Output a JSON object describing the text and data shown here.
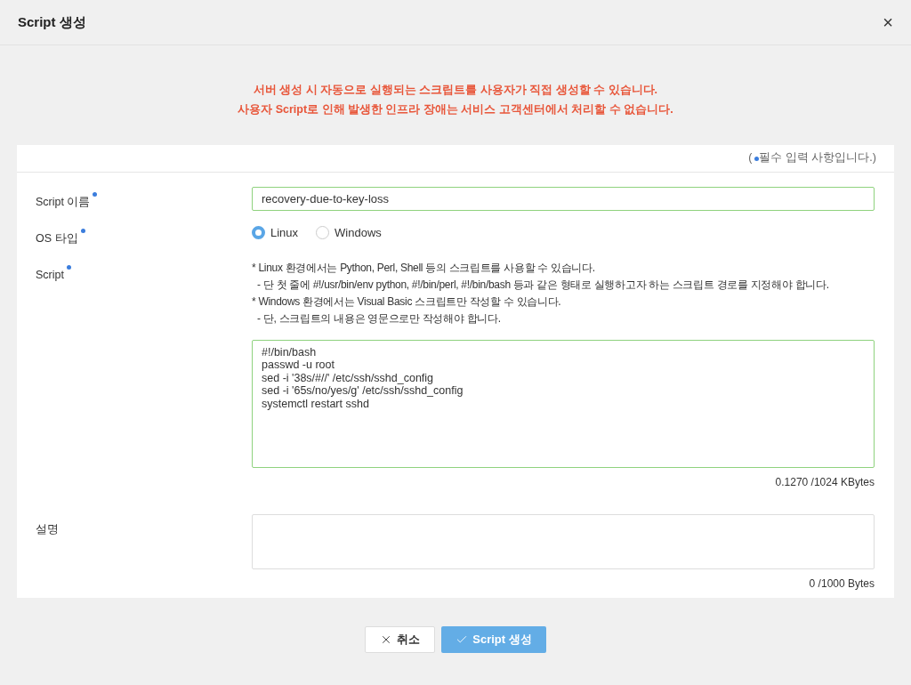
{
  "dialog": {
    "title": "Script 생성",
    "close": "×"
  },
  "notice": [
    "서버 생성 시 자동으로 실행되는 스크립트를 사용자가 직접 생성할 수 있습니다.",
    "사용자 Script로 인해 발생한 인프라 장애는 서비스 고객센터에서 처리할 수 없습니다."
  ],
  "required_note": {
    "open": "(",
    "text": "필수 입력 사항입니다.)"
  },
  "fields": [
    {
      "kind": "text",
      "label": "Script 이름",
      "required": true,
      "value": "recovery-due-to-key-loss"
    },
    {
      "kind": "radio",
      "label": "OS 타입",
      "required": true,
      "options": [
        {
          "label": "Linux",
          "selected": true
        },
        {
          "label": "Windows",
          "selected": false
        }
      ]
    },
    {
      "kind": "script",
      "label": "Script",
      "required": true,
      "help": [
        "* Linux 환경에서는 Python, Perl, Shell 등의 스크립트를 사용할 수 있습니다.",
        "  - 단 첫 줄에 #!/usr/bin/env python, #!/bin/perl, #!/bin/bash 등과 같은 형태로 실행하고자 하는 스크립트 경로를 지정해야 합니다.",
        "* Windows 환경에서는 Visual Basic 스크립트만 작성할 수 있습니다.",
        "  - 단, 스크립트의 내용은 영문으로만 작성해야 합니다."
      ],
      "value": "#!/bin/bash\npasswd -u root\nsed -i '38s/#//' /etc/ssh/sshd_config\nsed -i '65s/no/yes/g' /etc/ssh/sshd_config\nsystemctl restart sshd",
      "counter": "0.1270 /1024 KBytes"
    },
    {
      "kind": "textarea",
      "label": "설명",
      "required": false,
      "counter": "0 /1000 Bytes"
    }
  ],
  "buttons": [
    {
      "kind": "cancel",
      "label": "취소"
    },
    {
      "kind": "submit",
      "label": "Script 생성"
    }
  ]
}
